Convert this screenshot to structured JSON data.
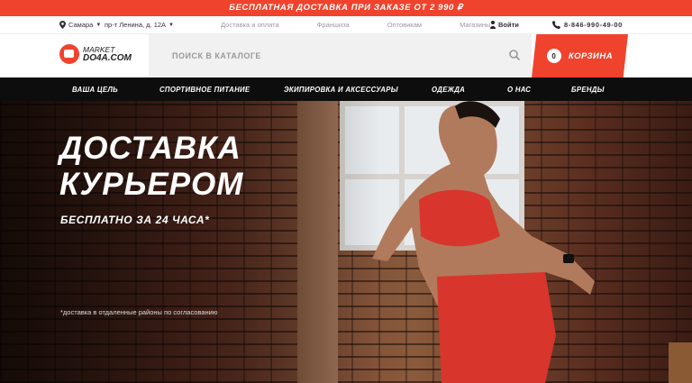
{
  "promo": {
    "text": "БЕСПЛАТНАЯ ДОСТАВКА ПРИ ЗАКАЗЕ ОТ 2 990 ₽"
  },
  "topbar": {
    "city": "Самара",
    "address": "пр-т Ленина, д. 12А",
    "links": [
      "Доставка и оплата",
      "Франшиза",
      "Оптовикам",
      "Магазины"
    ],
    "login": "Войти",
    "phone": "8-846-990-49-00"
  },
  "header": {
    "logo_line1": "MARKET",
    "logo_line2": "DO4A.COM",
    "search_placeholder": "ПОИСК В КАТАЛОГЕ",
    "cart_label": "КОРЗИНА",
    "cart_count": "0"
  },
  "nav": {
    "items": [
      "ВАША ЦЕЛЬ",
      "СПОРТИВНОЕ ПИТАНИЕ",
      "ЭКИПИРОВКА И АКСЕССУАРЫ",
      "ОДЕЖДА",
      "О НАС",
      "БРЕНДЫ"
    ]
  },
  "hero": {
    "title_line1": "ДОСТАВКА",
    "title_line2": "КУРЬЕРОМ",
    "subtitle": "БЕСПЛАТНО ЗА 24 ЧАСА*",
    "footnote": "*доставка в отдаленные районы по согласованию"
  },
  "colors": {
    "accent": "#f0432d",
    "nav_bg": "#0d0d0d"
  }
}
